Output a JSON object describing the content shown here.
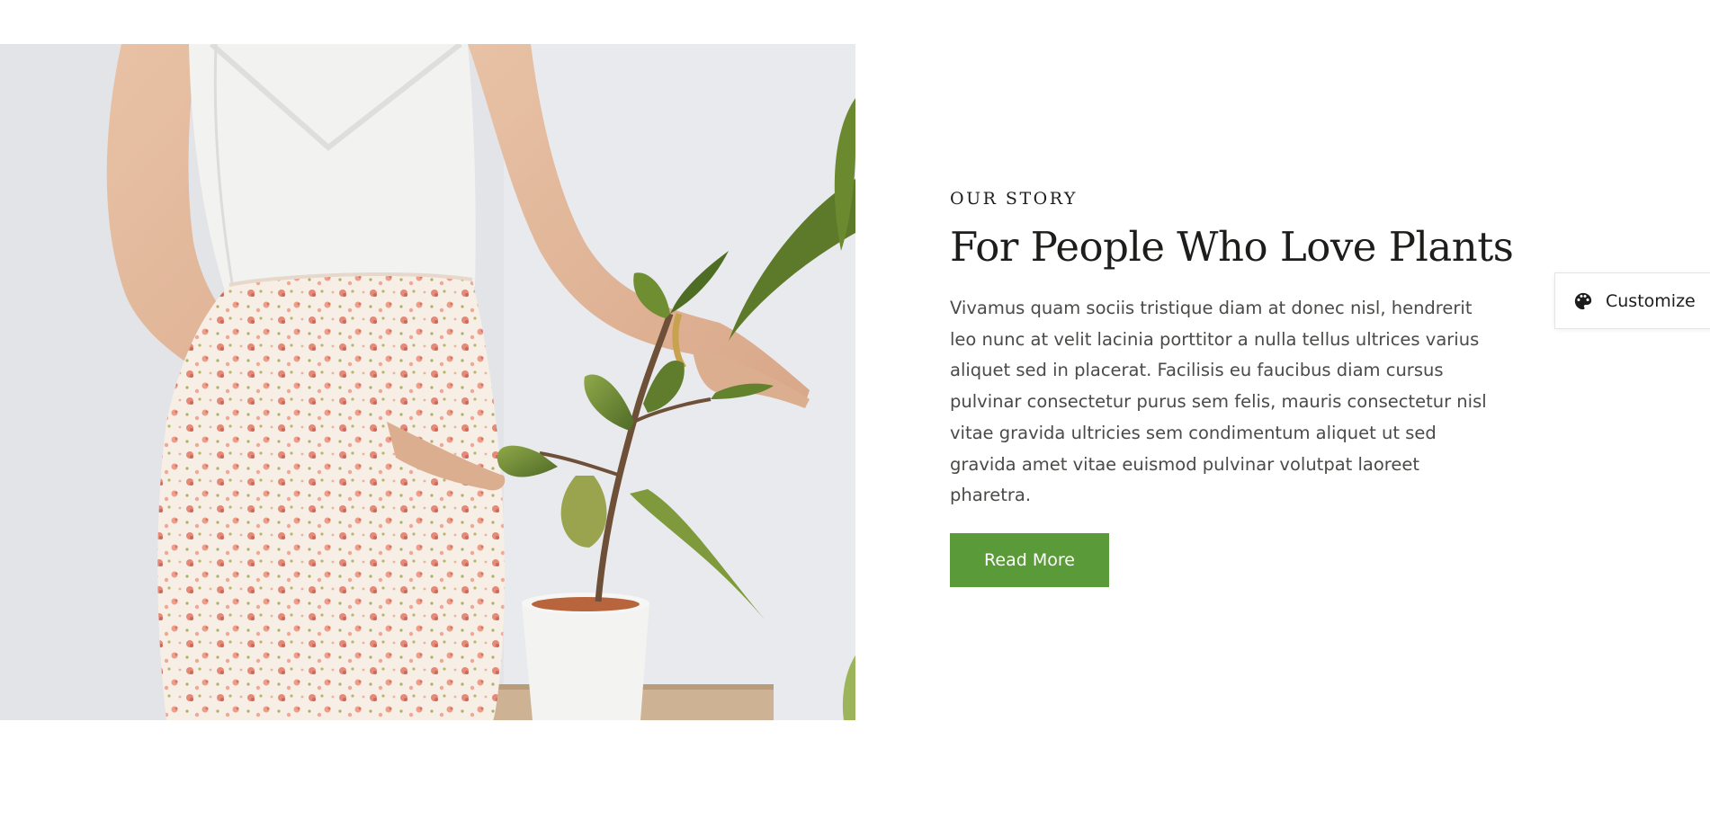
{
  "story": {
    "eyebrow": "OUR STORY",
    "title": "For People Who Love Plants",
    "body": "Vivamus quam sociis tristique diam at donec nisl, hendrerit leo nunc at velit lacinia porttitor a nulla tellus ultrices varius aliquet sed in placerat. Facilisis eu faucibus diam cursus pulvinar consectetur purus sem felis, mauris consectetur nisl vitae gravida ultricies sem condimentum aliquet ut sed gravida amet vitae euismod pulvinar volutpat laoreet pharetra.",
    "button_label": "Read More"
  },
  "customize": {
    "label": "Customize",
    "icon": "palette-icon"
  },
  "colors": {
    "accent": "#5a9a38",
    "heading": "#1d1d1b",
    "body_text": "#4a4a48"
  }
}
